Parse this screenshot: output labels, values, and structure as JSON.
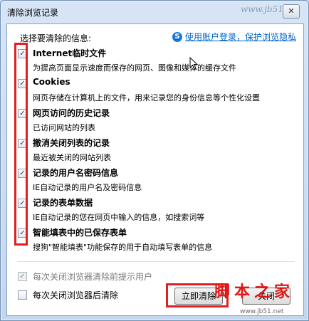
{
  "window": {
    "title": "清除浏览记录",
    "close_glyph": "✕"
  },
  "header": {
    "prompt": "选择要清除的信息:",
    "privacy_link": "使用账户登录，保护浏览隐私"
  },
  "items": [
    {
      "title": "Internet临时文件",
      "desc": "为提高页面显示速度而保存的网页、图像和媒体的缓存文件",
      "checked": true
    },
    {
      "title": "Cookies",
      "desc": "网页存储在计算机上的文件，用来记录您的身份信息等个性化设置",
      "checked": true
    },
    {
      "title": "网页访问的历史记录",
      "desc": "已访问网站的列表",
      "checked": true
    },
    {
      "title": "撤消关闭列表的记录",
      "desc": "最近被关闭的网站列表",
      "checked": true
    },
    {
      "title": "记录的用户名密码信息",
      "desc": "IE自动记录的用户名及密码信息",
      "checked": true
    },
    {
      "title": "记录的表单数据",
      "desc": "IE自动记录的您在网页中输入的信息，如搜索词等",
      "checked": true
    },
    {
      "title": "智能填表中的已保存表单",
      "desc": "搜狗\"智能填表\"功能保存的用于自动填写表单的信息",
      "checked": true
    }
  ],
  "options": {
    "prompt_on_close": {
      "label": "每次关闭浏览器清除前提示用户",
      "checked": true,
      "disabled": true
    },
    "clear_on_close": {
      "label": "每次关闭浏览器后清除",
      "checked": false
    }
  },
  "buttons": {
    "clear_now": "立即清除",
    "close": "关闭"
  },
  "watermark": {
    "top": "www.jb51.net",
    "logo": "脚本之家",
    "url": "www.jb51.net"
  },
  "icons": {
    "checkbox_mark": "✓",
    "privacy_icon": "S"
  }
}
